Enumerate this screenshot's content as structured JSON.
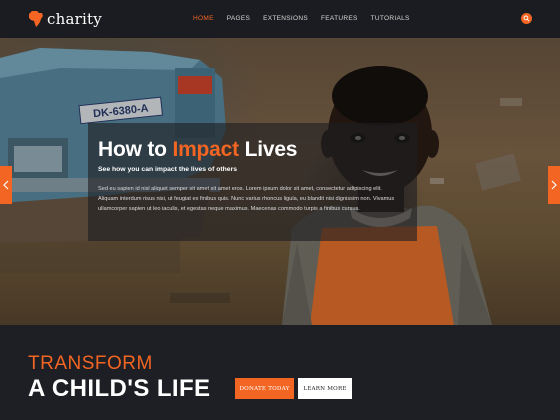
{
  "brand": {
    "name": "charity",
    "accent_color": "#f26522",
    "logo_icon": "africa-map-icon"
  },
  "nav": {
    "items": [
      {
        "label": "HOME",
        "active": true
      },
      {
        "label": "PAGES",
        "active": false
      },
      {
        "label": "EXTENSIONS",
        "active": false
      },
      {
        "label": "FEATURES",
        "active": false
      },
      {
        "label": "TUTORIALS",
        "active": false
      }
    ],
    "search_icon": "search-icon"
  },
  "hero": {
    "title_prefix": "How to",
    "title_highlight": "Impact",
    "title_suffix": "Lives",
    "subtitle": "See how you can impact the lives of others",
    "body": "Sed eu sapien id nisl aliquet semper sit amet sit amet eros. Lorem ipsum dolor sit amet, consectetur adipiscing elit. Aliquam interdum risus nisi, ut feugiat ex finibus quis. Nunc varius rhoncus ligula, eu blandit nisi dignissim non. Vivamus ullamcorper sapien ut leo iaculis, et egestas neque maximus. Maecenas commodo turpis a finibus cursus.",
    "license_plate": "DK-6380-A",
    "prev_icon": "chevron-left-icon",
    "next_icon": "chevron-right-icon"
  },
  "cta": {
    "line1": "TRANSFORM",
    "line2": "A CHILD'S LIFE",
    "donate_label": "DONATE TODAY",
    "learn_label": "LEARN MORE"
  }
}
